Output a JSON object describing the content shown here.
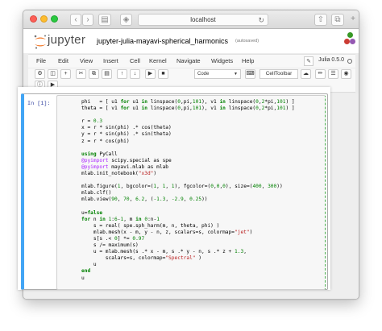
{
  "browser": {
    "url": "localhost",
    "colors": {
      "close": "#fc5f57",
      "minimize": "#fdbc2e",
      "zoom": "#2ac840"
    }
  },
  "header": {
    "logo_text": "jupyter",
    "notebook_name": "jupyter-julia-mayavi-spherical_harmonics",
    "autosave_status": "(autosaved)"
  },
  "menu": {
    "items": [
      "File",
      "Edit",
      "View",
      "Insert",
      "Cell",
      "Kernel",
      "Navigate",
      "Widgets",
      "Help"
    ],
    "kernel_name": "Julia 0.5.0"
  },
  "toolbar": {
    "cell_type": "Code",
    "celltoolbar_label": "CellToolbar"
  },
  "cell": {
    "prompt": "In [1]:",
    "accent_color": "#42a5f5",
    "lines": [
      [
        [
          "t",
          "phi   = [ u1 "
        ],
        [
          "kw",
          "for"
        ],
        [
          "t",
          " u1 "
        ],
        [
          "kw",
          "in"
        ],
        [
          "t",
          " linspace("
        ],
        [
          "num",
          "0"
        ],
        [
          "t",
          ",pi,"
        ],
        [
          "num",
          "101"
        ],
        [
          "t",
          "), v1 "
        ],
        [
          "kw",
          "in"
        ],
        [
          "t",
          " linspace("
        ],
        [
          "num",
          "0"
        ],
        [
          "t",
          ","
        ],
        [
          "num",
          "2"
        ],
        [
          "t",
          "*pi,"
        ],
        [
          "num",
          "101"
        ],
        [
          "t",
          ") ]"
        ]
      ],
      [
        [
          "t",
          "theta = [ v1 "
        ],
        [
          "kw",
          "for"
        ],
        [
          "t",
          " u1 "
        ],
        [
          "kw",
          "in"
        ],
        [
          "t",
          " linspace("
        ],
        [
          "num",
          "0"
        ],
        [
          "t",
          ",pi,"
        ],
        [
          "num",
          "101"
        ],
        [
          "t",
          "), v1 "
        ],
        [
          "kw",
          "in"
        ],
        [
          "t",
          " linspace("
        ],
        [
          "num",
          "0"
        ],
        [
          "t",
          ","
        ],
        [
          "num",
          "2"
        ],
        [
          "t",
          "*pi,"
        ],
        [
          "num",
          "101"
        ],
        [
          "t",
          ") ]"
        ]
      ],
      [],
      [
        [
          "t",
          "r = "
        ],
        [
          "num",
          "0.3"
        ]
      ],
      [
        [
          "t",
          "x = r * sin(phi) .* cos(theta)"
        ]
      ],
      [
        [
          "t",
          "y = r * sin(phi) .* sin(theta)"
        ]
      ],
      [
        [
          "t",
          "z = r * cos(phi)"
        ]
      ],
      [],
      [
        [
          "kw",
          "using"
        ],
        [
          "t",
          " PyCall"
        ]
      ],
      [
        [
          "dec",
          "@pyimport"
        ],
        [
          "t",
          " scipy.special as spe"
        ]
      ],
      [
        [
          "dec",
          "@pyimport"
        ],
        [
          "t",
          " mayavi.mlab as mlab"
        ]
      ],
      [
        [
          "t",
          "mlab.init_notebook("
        ],
        [
          "str",
          "\"x3d\""
        ],
        [
          "t",
          ")"
        ]
      ],
      [],
      [
        [
          "t",
          "mlab.figure("
        ],
        [
          "num",
          "1"
        ],
        [
          "t",
          ", bgcolor=("
        ],
        [
          "num",
          "1"
        ],
        [
          "t",
          ", "
        ],
        [
          "num",
          "1"
        ],
        [
          "t",
          ", "
        ],
        [
          "num",
          "1"
        ],
        [
          "t",
          "), fgcolor=("
        ],
        [
          "num",
          "0"
        ],
        [
          "t",
          ","
        ],
        [
          "num",
          "0"
        ],
        [
          "t",
          ","
        ],
        [
          "num",
          "0"
        ],
        [
          "t",
          "), size=("
        ],
        [
          "num",
          "400"
        ],
        [
          "t",
          ", "
        ],
        [
          "num",
          "300"
        ],
        [
          "t",
          "))"
        ]
      ],
      [
        [
          "t",
          "mlab.clf()"
        ]
      ],
      [
        [
          "t",
          "mlab.view("
        ],
        [
          "num",
          "90"
        ],
        [
          "t",
          ", "
        ],
        [
          "num",
          "70"
        ],
        [
          "t",
          ", "
        ],
        [
          "num",
          "6.2"
        ],
        [
          "t",
          ", ("
        ],
        [
          "num",
          "-1.3"
        ],
        [
          "t",
          ", "
        ],
        [
          "num",
          "-2.9"
        ],
        [
          "t",
          ", "
        ],
        [
          "num",
          "0.25"
        ],
        [
          "t",
          "))"
        ]
      ],
      [],
      [
        [
          "t",
          "u="
        ],
        [
          "kw",
          "false"
        ]
      ],
      [
        [
          "kw",
          "for"
        ],
        [
          "t",
          " n "
        ],
        [
          "kw",
          "in"
        ],
        [
          "t",
          " "
        ],
        [
          "num",
          "1"
        ],
        [
          "t",
          ":"
        ],
        [
          "num",
          "6"
        ],
        [
          "t",
          "-"
        ],
        [
          "num",
          "1"
        ],
        [
          "t",
          ", m "
        ],
        [
          "kw",
          "in"
        ],
        [
          "t",
          " "
        ],
        [
          "num",
          "0"
        ],
        [
          "t",
          ":n-"
        ],
        [
          "num",
          "1"
        ]
      ],
      [
        [
          "t",
          "    s = real( spe.sph_harm(m, n, theta, phi) )"
        ]
      ],
      [
        [
          "t",
          "    mlab.mesh(x - m, y - n, z, scalars=s, colormap="
        ],
        [
          "str",
          "\"jet\""
        ],
        [
          "t",
          ")"
        ]
      ],
      [
        [
          "t",
          "    s[s .< "
        ],
        [
          "num",
          "0"
        ],
        [
          "t",
          "] *= "
        ],
        [
          "num",
          "0.97"
        ]
      ],
      [
        [
          "t",
          "    s /= maximum(s)"
        ]
      ],
      [
        [
          "t",
          "    u = mlab.mesh(s .* x - m, s .* y - n, s .* z + "
        ],
        [
          "num",
          "1.3"
        ],
        [
          "t",
          ","
        ]
      ],
      [
        [
          "t",
          "        scalars=s, colormap="
        ],
        [
          "str",
          "\"Spectral\""
        ],
        [
          "t",
          " )"
        ]
      ],
      [
        [
          "t",
          "    u"
        ]
      ],
      [
        [
          "kw",
          "end"
        ]
      ],
      [
        [
          "t",
          "u"
        ]
      ]
    ]
  }
}
